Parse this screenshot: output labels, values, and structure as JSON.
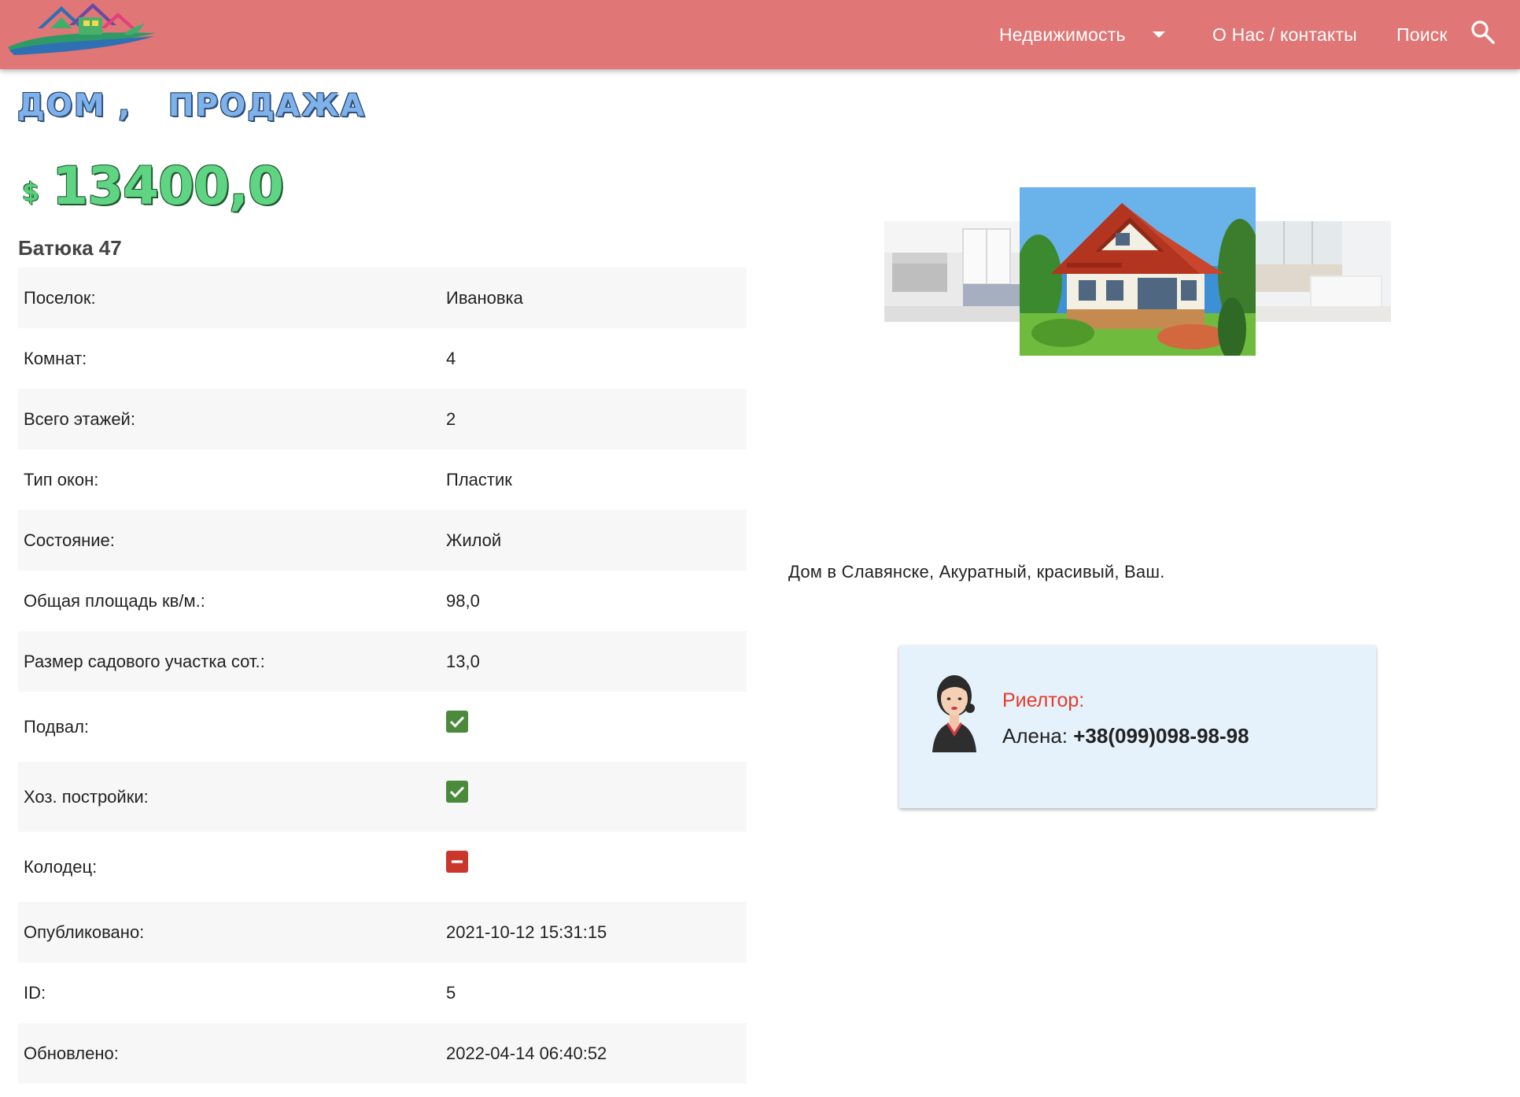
{
  "header": {
    "nav": {
      "realty": "Недвижимость",
      "about": "О Нас / контакты",
      "search": "Поиск"
    }
  },
  "listing": {
    "title": "дом ,   продажа",
    "currency": "$",
    "price": "13400,0",
    "address": "Батюка 47",
    "description": "Дом в Славянске, Акуратный, красивый, Ваш."
  },
  "attributes": [
    {
      "label": "Поселок:",
      "value": "Ивановка",
      "kind": "text"
    },
    {
      "label": "Комнат:",
      "value": "4",
      "kind": "text"
    },
    {
      "label": "Всего этажей:",
      "value": "2",
      "kind": "text"
    },
    {
      "label": "Тип окон:",
      "value": "Пластик",
      "kind": "text"
    },
    {
      "label": "Состояние:",
      "value": "Жилой",
      "kind": "text"
    },
    {
      "label": "Общая площадь кв/м.:",
      "value": "98,0",
      "kind": "text"
    },
    {
      "label": "Размер садового участка сот.:",
      "value": "13,0",
      "kind": "text"
    },
    {
      "label": "Подвал:",
      "value": true,
      "kind": "bool"
    },
    {
      "label": "Хоз. постройки:",
      "value": true,
      "kind": "bool"
    },
    {
      "label": "Колодец:",
      "value": false,
      "kind": "bool"
    },
    {
      "label": "Опубликовано:",
      "value": "2021-10-12 15:31:15",
      "kind": "text"
    },
    {
      "label": "ID:",
      "value": "5",
      "kind": "text"
    },
    {
      "label": "Обновлено:",
      "value": "2022-04-14 06:40:52",
      "kind": "text"
    }
  ],
  "realtor": {
    "role": "Риелтор:",
    "name": "Алена: ",
    "phone": "+38(099)098-98-98"
  },
  "colors": {
    "header": "#e07676",
    "price": "#5fd584",
    "title": "#7fb2ea",
    "realtor_card": "#e6f2fb",
    "realtor_role": "#e53b2a",
    "check_yes": "#4a8a3a",
    "check_no": "#c9372c"
  },
  "icons": {
    "logo": "house-logo",
    "nav_caret": "chevron-down-icon",
    "search": "search-icon",
    "check_yes": "checkbox-checked-icon",
    "check_no": "checkbox-indeterminate-icon"
  }
}
